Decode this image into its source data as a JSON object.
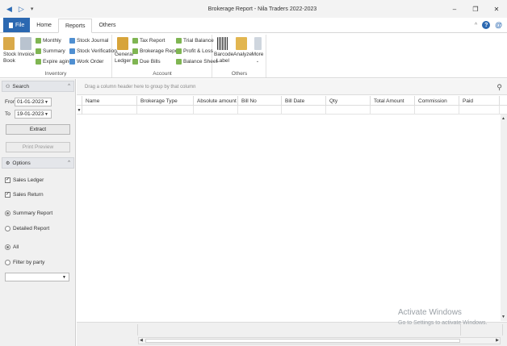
{
  "window": {
    "title": "Brokerage Report - Nila Traders 2022-2023",
    "controls": {
      "minimize": "–",
      "restore": "❐",
      "close": "✕"
    }
  },
  "ribbon_tabs": [
    {
      "label": "File"
    },
    {
      "label": "Home"
    },
    {
      "label": "Reports"
    },
    {
      "label": "Others"
    }
  ],
  "ribbon": {
    "inventory": {
      "label": "Inventory",
      "stock_book": "Stock Book",
      "invoice": "Invoice",
      "monthly": "Monthly",
      "summary": "Summary",
      "expire_aging": "Expire aging",
      "stock_journal": "Stock Journal",
      "stock_verification": "Stock Verification",
      "work_order": "Work Order"
    },
    "account": {
      "label": "Account",
      "general_ledger": "General Ledger",
      "tax_report": "Tax Report",
      "brokerage_report": "Brokerage Report",
      "due_bills": "Due Bills",
      "trial_balance": "Trial Balance",
      "profit_loss": "Profit & Loss",
      "balance_sheet": "Balance Sheet"
    },
    "others": {
      "label": "Others",
      "barcode_label": "Barcode Label",
      "analyze": "Analyze",
      "more": "More"
    }
  },
  "search_panel": {
    "header": "Search",
    "from_label": "From",
    "from_value": "01-01-2023",
    "to_label": "To",
    "to_value": "19-01-2023",
    "extract": "Extract",
    "print_preview": "Print Preview"
  },
  "options_panel": {
    "header": "Options",
    "sales_ledger": "Sales Ledger",
    "sales_return": "Sales Return",
    "summary_report": "Summary Report",
    "detailed_report": "Detailed Report",
    "all": "All",
    "filter_by_party": "Filter by party"
  },
  "grid": {
    "group_hint": "Drag a column header here to group by that column",
    "columns": [
      "Name",
      "Brokerage Type",
      "Absolute amount",
      "Bill No",
      "Bill Date",
      "Qty",
      "Total Amount",
      "Commission",
      "Paid"
    ]
  },
  "watermark": {
    "line1": "Activate Windows",
    "line2": "Go to Settings to activate Windows."
  }
}
